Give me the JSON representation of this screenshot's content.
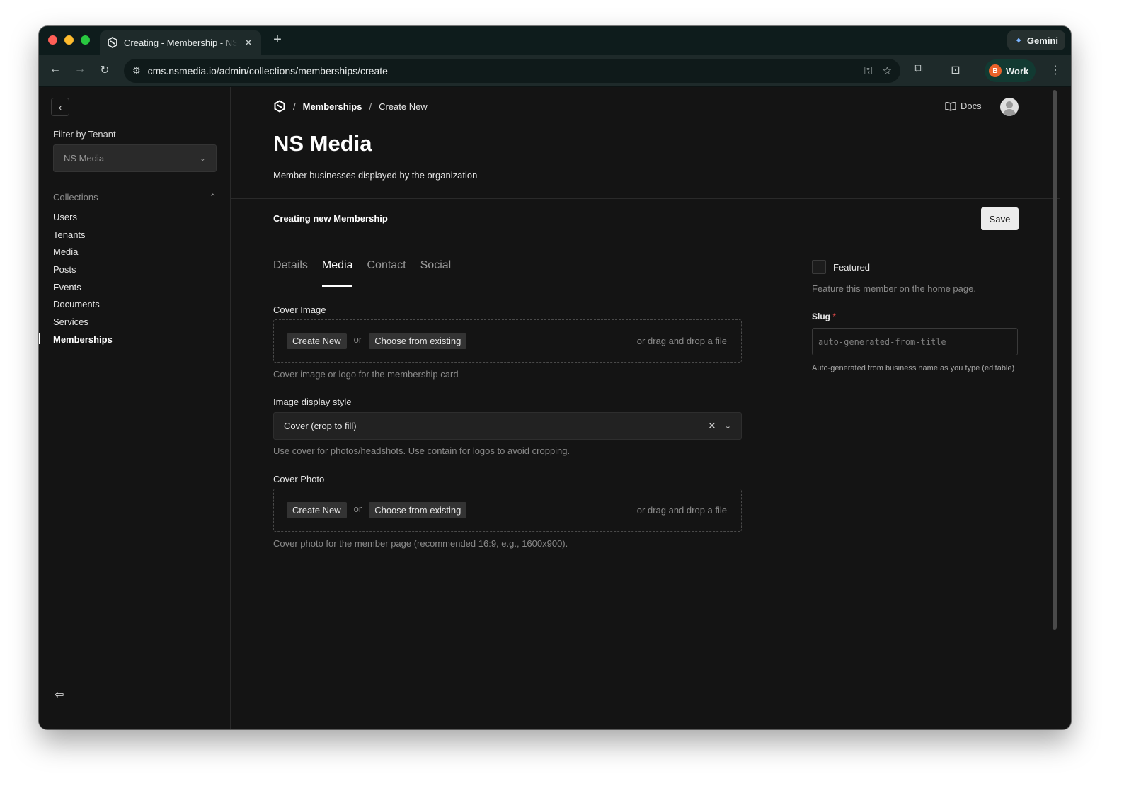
{
  "browser": {
    "tab_title": "Creating - Membership - NS Media",
    "new_tab": "+",
    "gemini_label": "Gemini",
    "url": "cms.nsmedia.io/admin/collections/memberships/create",
    "profile_initial": "B",
    "profile_name": "Work"
  },
  "sidebar": {
    "filter_label": "Filter by Tenant",
    "tenant_selected": "NS Media",
    "collections_heading": "Collections",
    "items": [
      {
        "label": "Users"
      },
      {
        "label": "Tenants"
      },
      {
        "label": "Media"
      },
      {
        "label": "Posts"
      },
      {
        "label": "Events"
      },
      {
        "label": "Documents"
      },
      {
        "label": "Services"
      },
      {
        "label": "Memberships"
      }
    ]
  },
  "header": {
    "breadcrumb_sep": "/",
    "breadcrumb_collection": "Memberships",
    "breadcrumb_current": "Create New",
    "docs_label": "Docs",
    "title": "NS Media",
    "description": "Member businesses displayed by the organization"
  },
  "editbar": {
    "status": "Creating new Membership",
    "save_label": "Save"
  },
  "tabs": [
    "Details",
    "Media",
    "Contact",
    "Social"
  ],
  "form": {
    "cover_image": {
      "label": "Cover Image",
      "create_label": "Create New",
      "or_label": "or",
      "choose_label": "Choose from existing",
      "drag_label": "or drag and drop a file",
      "help": "Cover image or logo for the membership card"
    },
    "display_style": {
      "label": "Image display style",
      "value": "Cover (crop to fill)",
      "help": "Use cover for photos/headshots. Use contain for logos to avoid cropping."
    },
    "cover_photo": {
      "label": "Cover Photo",
      "create_label": "Create New",
      "or_label": "or",
      "choose_label": "Choose from existing",
      "drag_label": "or drag and drop a file",
      "help": "Cover photo for the member page (recommended 16:9, e.g., 1600x900)."
    }
  },
  "aside": {
    "featured_label": "Featured",
    "featured_help": "Feature this member on the home page.",
    "slug_label": "Slug",
    "slug_required": "*",
    "slug_placeholder": "auto-generated-from-title",
    "slug_help": "Auto-generated from business name as you type (editable)"
  },
  "colors": {
    "page_bg": "#141414",
    "browser_chrome": "#1e2a2a",
    "required": "#e04a4a"
  }
}
